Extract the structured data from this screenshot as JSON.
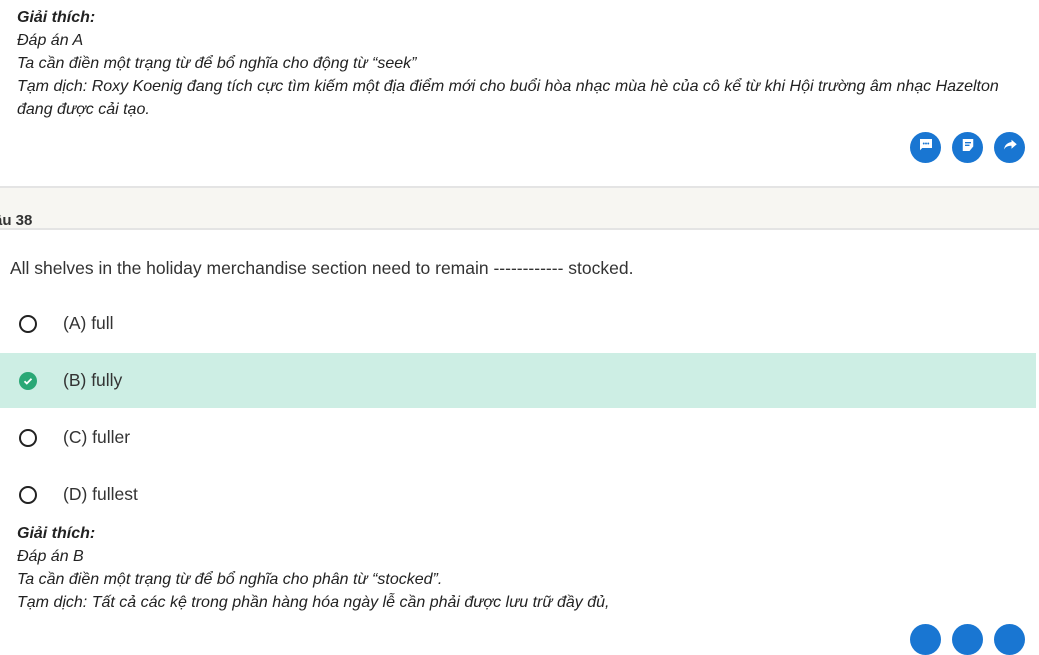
{
  "explanation_top": {
    "title": "Giải thích:",
    "answer": "Đáp án A",
    "line1": "Ta cần điền một trạng từ để bổ nghĩa cho động từ “seek”",
    "line2": "Tạm dịch: Roxy Koenig đang tích cực tìm kiếm một địa điểm mới cho buổi hòa nhạc mùa hè của cô kể từ khi Hội trường âm nhạc Hazelton đang được cải tạo."
  },
  "actions": {
    "comment_icon": "comment-icon",
    "note_icon": "note-icon",
    "share_icon": "share-icon"
  },
  "question": {
    "label": "âu 38",
    "text": "All shelves in the holiday merchandise section need to remain ------------ stocked.",
    "options": [
      {
        "label": "(A) full",
        "selected": false
      },
      {
        "label": "(B) fully",
        "selected": true
      },
      {
        "label": "(C) fuller",
        "selected": false
      },
      {
        "label": "(D) fullest",
        "selected": false
      }
    ]
  },
  "explanation_bottom": {
    "title": "Giải thích:",
    "answer": "Đáp án B",
    "line1": "Ta cần điền một trạng từ để bổ nghĩa cho phân từ “stocked”.",
    "line2": "Tạm dịch: Tất cả các kệ trong phần hàng hóa ngày lễ cần phải được lưu trữ đầy đủ,"
  },
  "colors": {
    "accent": "#1976d2",
    "correct_bg": "#cdeee4",
    "correct_check": "#2aa876"
  }
}
